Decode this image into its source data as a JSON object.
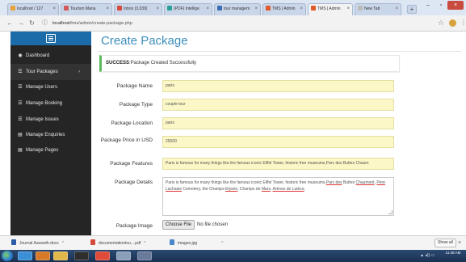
{
  "browser": {
    "tabs": [
      {
        "label": "localhost / 127",
        "color": "#e8a23a"
      },
      {
        "label": "Tourism Mana",
        "color": "#d35a5a"
      },
      {
        "label": "Inbox (3,039)",
        "color": "#d54b3d"
      },
      {
        "label": "(PDF) Intellige",
        "color": "#2aa198"
      },
      {
        "label": "tour managem",
        "color": "#3b6fb5"
      },
      {
        "label": "TMS | Admin",
        "color": "#e05a2a"
      },
      {
        "label": "TMS | Admin",
        "color": "#e05a2a"
      },
      {
        "label": "New Tab",
        "color": "#bbbbbb"
      }
    ],
    "new_tab_glyph": "+",
    "url_host": "localhost",
    "url_path": "/tms/admin/create-package.php",
    "icons": {
      "back": "back-arrow-icon",
      "forward": "forward-arrow-icon",
      "reload": "reload-icon",
      "info": "info-icon",
      "star": "bookmark-star-icon",
      "menu": "menu-dots-icon"
    }
  },
  "sidebar": {
    "items": [
      {
        "label": "Dashboard",
        "icon": "dashboard-icon",
        "glyph": "◉"
      },
      {
        "label": "Tour Packages",
        "icon": "list-icon",
        "glyph": "☰",
        "arrow": "›"
      },
      {
        "label": "Manage Users",
        "icon": "list-icon",
        "glyph": "☰"
      },
      {
        "label": "Manage Booking",
        "icon": "list-icon",
        "glyph": "☰"
      },
      {
        "label": "Manage Issues",
        "icon": "list-icon",
        "glyph": "☰"
      },
      {
        "label": "Manage Enquiries",
        "icon": "file-icon",
        "glyph": "▤"
      },
      {
        "label": "Manage Pages",
        "icon": "file-icon",
        "glyph": "▤"
      }
    ]
  },
  "page": {
    "title": "Create Package",
    "alert_strong": "SUCCESS",
    "alert_text": ":Package Created Successfully"
  },
  "form": {
    "name_label": "Package Name",
    "name_value": "paris",
    "type_label": "Package Type",
    "type_value": "couple tour",
    "location_label": "Package Location",
    "location_value": "paris",
    "price_label": "Package Price in USD",
    "price_value": "25000",
    "features_label": "Package Features",
    "features_value": "Paris is famous for many things like the famous iconic Eiffel Tower, historic free museums,Parc des Buttes Chaum",
    "details_label": "Package Details",
    "details_1": "Paris is famous for many things like the famous iconic Eiffel Tower, historic free museums,",
    "details_2": "Parc des",
    "details_3": " Buttes ",
    "details_4": "Chaumont",
    "details_5": ", ",
    "details_6": "Pere Lachaise",
    "details_7": " Cemetery, the Champs-",
    "details_8": "Elysée",
    "details_9": ", Champs de ",
    "details_10": "Mars",
    "details_11": ", ",
    "details_12": "Arènes de Lutèce",
    "details_13": ".",
    "image_label": "Package Image",
    "file_button": "Choose File",
    "file_status": "No file chosen"
  },
  "downloads": {
    "items": [
      {
        "label": "Journal Aswanth.docx",
        "color": "#2b5ca8"
      },
      {
        "label": "documentationtou....pdf",
        "color": "#d24a3a"
      },
      {
        "label": "images.jpg",
        "color": "#4a86c8"
      }
    ],
    "caret": "^",
    "show_all": "Show all",
    "close": "×"
  },
  "taskbar": {
    "apps": [
      {
        "icon": "ie-icon",
        "color": "#3a8fd6"
      },
      {
        "icon": "media-icon",
        "color": "#d67a2a"
      },
      {
        "icon": "explorer-icon",
        "color": "#e0b84a"
      },
      {
        "icon": "terminal-icon",
        "color": "#2e2e2e"
      },
      {
        "icon": "chrome-icon",
        "color": "#e04a3a"
      },
      {
        "icon": "tool-icon",
        "color": "#8aa0b8"
      },
      {
        "icon": "app-icon",
        "color": "#6a7a9a"
      }
    ],
    "time": "11:48 AM"
  }
}
